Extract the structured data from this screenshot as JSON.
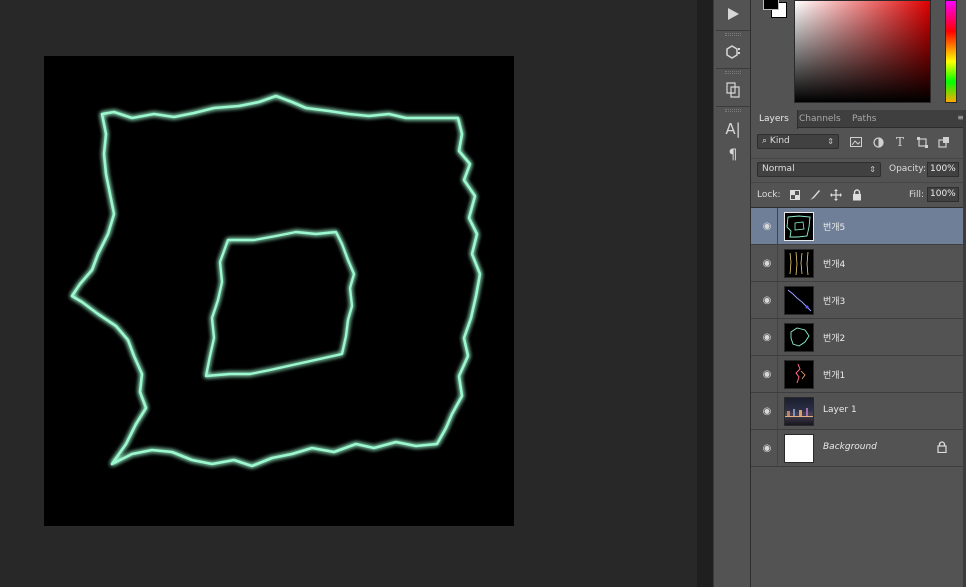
{
  "panel_tabs": {
    "layers": "Layers",
    "channels": "Channels",
    "paths": "Paths",
    "menu_icon": "panel-menu-icon"
  },
  "filter": {
    "kind_label": "Kind",
    "icons": [
      "image-filter-icon",
      "adjustment-filter-icon",
      "type-filter-icon",
      "shape-filter-icon",
      "smart-object-filter-icon"
    ]
  },
  "blend": {
    "mode": "Normal",
    "opacity_label": "Opacity:",
    "opacity_value": "100%"
  },
  "lock": {
    "label": "Lock:",
    "fill_label": "Fill:",
    "fill_value": "100%"
  },
  "layers": [
    {
      "name": "번개5",
      "selected": true,
      "thumb": "lightning-frame"
    },
    {
      "name": "번개4",
      "selected": false,
      "thumb": "lightning-lines"
    },
    {
      "name": "번개3",
      "selected": false,
      "thumb": "lightning-diagonal"
    },
    {
      "name": "번개2",
      "selected": false,
      "thumb": "lightning-loop"
    },
    {
      "name": "번개1",
      "selected": false,
      "thumb": "lightning-pink"
    },
    {
      "name": "Layer 1",
      "selected": false,
      "thumb": "night-city-photo"
    },
    {
      "name": "Background",
      "selected": false,
      "thumb": "white",
      "locked": true
    }
  ],
  "colors": {
    "foreground": "#000000",
    "background": "#ffffff",
    "glow": "#7df5c0",
    "selection": "#6f7f98"
  },
  "tool_strip": {
    "icons": [
      "play-icon",
      "3d-cube-icon",
      "clone-source-icon",
      "character-icon",
      "paragraph-icon"
    ]
  }
}
